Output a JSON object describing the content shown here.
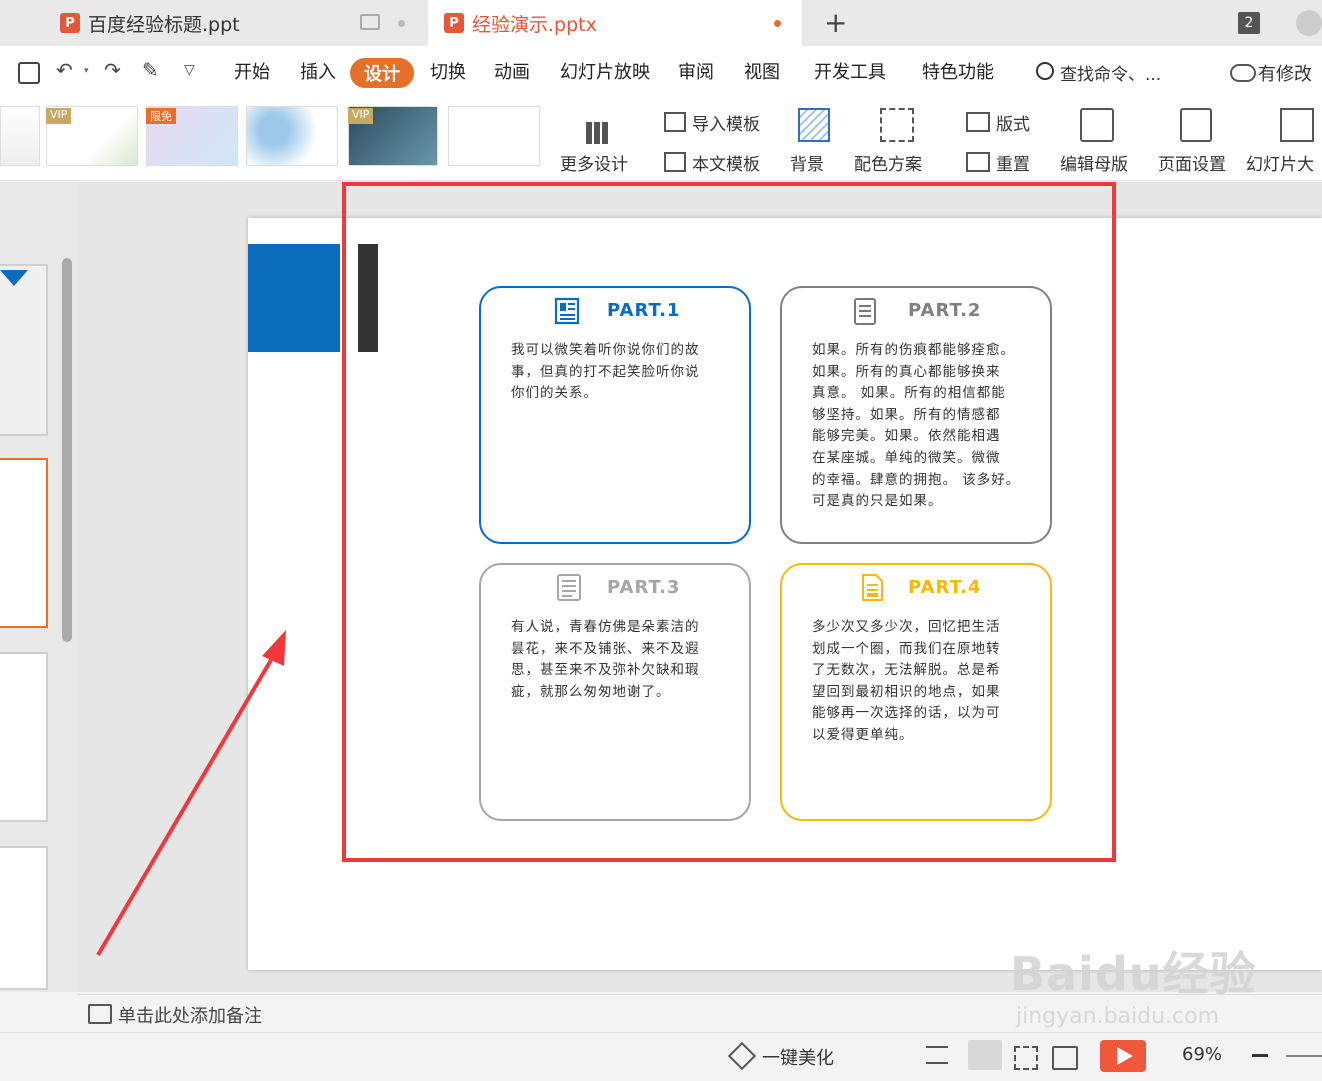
{
  "tabs": [
    {
      "label": "百度经验标题.ppt"
    },
    {
      "label": "经验演示.pptx"
    }
  ],
  "tab_counter": "2",
  "menu": {
    "items": [
      "开始",
      "插入",
      "设计",
      "切换",
      "动画",
      "幻灯片放映",
      "审阅",
      "视图",
      "开发工具",
      "特色功能"
    ],
    "active": "设计",
    "search_placeholder": "查找命令、...",
    "revise": "有修改"
  },
  "ribbon": {
    "badges": [
      "VIP",
      "限免",
      "VIP"
    ],
    "more_design": "更多设计",
    "import_template": "导入模板",
    "text_template": "本文模板",
    "background": "背景",
    "color_scheme": "配色方案",
    "layout": "版式",
    "reset": "重置",
    "edit_master": "编辑母版",
    "page_setup": "页面设置",
    "slide_size": "幻灯片大"
  },
  "slide": {
    "cards": [
      {
        "title": "PART.1",
        "color": "#0b6bbd",
        "icon": "newspaper-icon",
        "text": "我可以微笑着听你说你们的故\n事，但真的打不起笑脸听你说\n你们的关系。"
      },
      {
        "title": "PART.2",
        "color": "#808080",
        "icon": "document-icon",
        "text": "如果。所有的伤痕都能够痊愈。\n如果。所有的真心都能够换来\n真意。 如果。所有的相信都能\n够坚持。如果。所有的情感都\n能够完美。如果。依然能相遇\n在某座城。单纯的微笑。微微\n的幸福。肆意的拥抱。 该多好。\n可是真的只是如果。"
      },
      {
        "title": "PART.3",
        "color": "#a6a6a6",
        "icon": "notes-icon",
        "text": "有人说，青春仿佛是朵素洁的\n昙花，来不及铺张、来不及遐\n思，甚至来不及弥补欠缺和瑕\n疵，就那么匆匆地谢了。"
      },
      {
        "title": "PART.4",
        "color": "#f5b90a",
        "icon": "file-text-icon",
        "text": "多少次又多少次，回忆把生活\n划成一个圈，而我们在原地转\n了无数次，无法解脱。总是希\n望回到最初相识的地点，如果\n能够再一次选择的话，以为可\n以爱得更单纯。"
      }
    ]
  },
  "notes_placeholder": "单击此处添加备注",
  "status": {
    "beautify": "一键美化",
    "zoom": "69%"
  },
  "watermark": {
    "brand": "Baidu经验",
    "url": "jingyan.baidu.com"
  }
}
